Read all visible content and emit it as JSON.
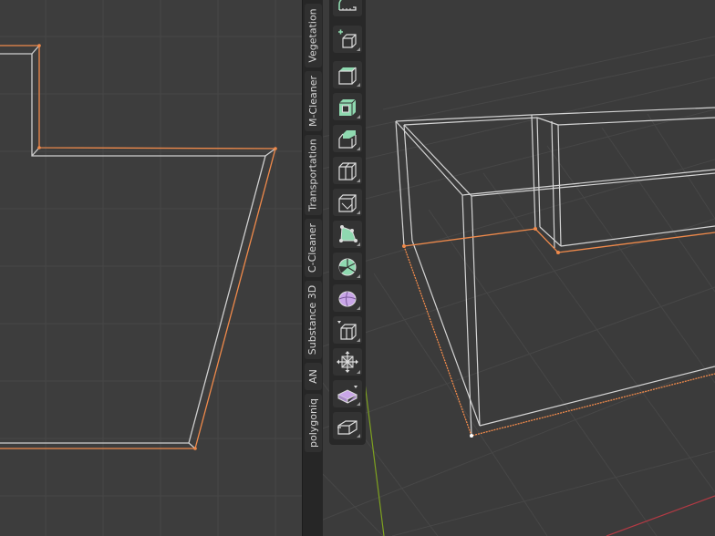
{
  "sidebar": {
    "tabs": [
      {
        "label": "Vegetation"
      },
      {
        "label": "M-Cleaner"
      },
      {
        "label": "Transportation"
      },
      {
        "label": "C-Cleaner"
      },
      {
        "label": "Substance 3D"
      },
      {
        "label": "AN"
      },
      {
        "label": "polygoniq"
      }
    ]
  },
  "toolbar": {
    "tools": [
      {
        "icon": "measure-icon"
      },
      {
        "icon": "add-cube-icon"
      },
      {
        "icon": "extrude-region-icon"
      },
      {
        "icon": "inset-faces-icon"
      },
      {
        "icon": "bevel-icon"
      },
      {
        "icon": "loop-cut-icon"
      },
      {
        "icon": "knife-icon"
      },
      {
        "icon": "poly-build-icon"
      },
      {
        "icon": "spin-icon"
      },
      {
        "icon": "smooth-icon"
      },
      {
        "icon": "edge-slide-icon"
      },
      {
        "icon": "shrink-fatten-icon"
      },
      {
        "icon": "shear-icon"
      },
      {
        "icon": "rip-region-icon"
      }
    ]
  },
  "colors": {
    "background": "#3d3d3d",
    "grid": "#4a4a4a",
    "wire": "#d9d9d9",
    "selected_edge": "#f08a4b",
    "tool_accent": "#8fd9b0",
    "y_axis": "#7fa31f",
    "x_axis": "#b33a44"
  }
}
